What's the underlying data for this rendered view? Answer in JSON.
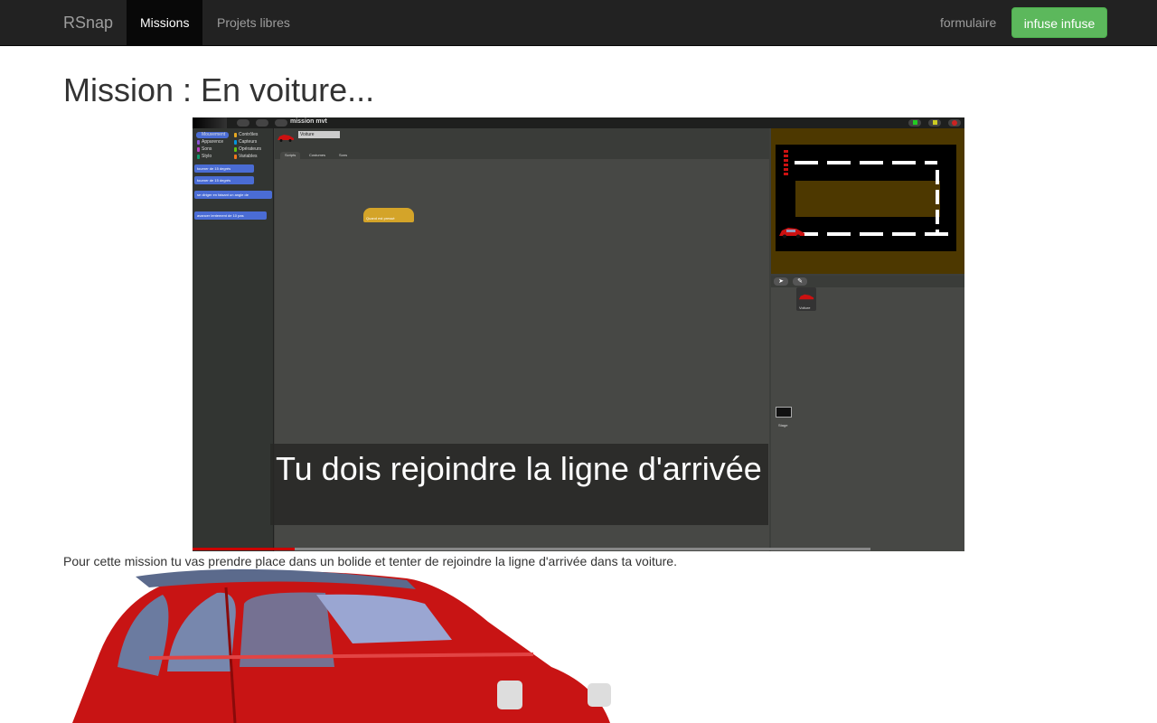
{
  "navbar": {
    "brand": "RSnap",
    "items": [
      {
        "label": "Missions",
        "active": true
      },
      {
        "label": "Projets libres",
        "active": false
      }
    ],
    "right_link": "formulaire",
    "user_button": "infuse infuse"
  },
  "page": {
    "title": "Mission : En voiture...",
    "description": "Pour cette mission tu vas prendre place dans un bolide et tenter de rejoindre la ligne d'arrivée dans ta voiture."
  },
  "video": {
    "project_name": "mission mvt",
    "sprite_name": "Voiture",
    "categories": [
      "Mouvement",
      "Apparence",
      "Sons",
      "Stylo",
      "Contrôles",
      "Capteurs",
      "Opérateurs",
      "Variables"
    ],
    "blocks": [
      "tourner de 15 degrés",
      "tourner de 15 degrés",
      "se diriger en faisant un angle de",
      "avancer lentement de 10 pas"
    ],
    "tabs": [
      "Scripts",
      "Costumes",
      "Sons"
    ],
    "hat_block": "Quand est pressé",
    "sprite_thumb_label": "Voiture",
    "stage_thumb_label": "Stage",
    "caption": "Tu dois rejoindre la ligne d'arrivée",
    "progress": 0.15
  },
  "colors": {
    "navbar_bg": "#222222",
    "success": "#5cb85c",
    "car_red": "#cc1111"
  }
}
